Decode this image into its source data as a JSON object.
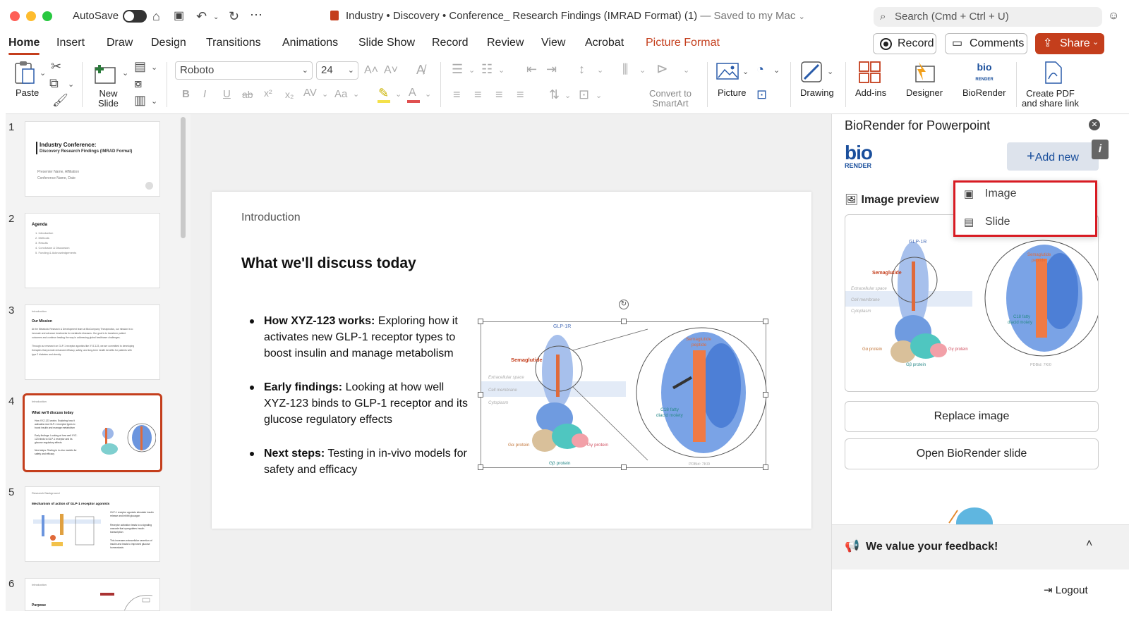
{
  "titlebar": {
    "autosave_label": "AutoSave",
    "document_title": "Industry • Discovery • Conference_ Research Findings (IMRAD Format) (1)",
    "save_status": "— Saved to my Mac",
    "search_placeholder": "Search (Cmd + Ctrl + U)"
  },
  "tabs": [
    "Home",
    "Insert",
    "Draw",
    "Design",
    "Transitions",
    "Animations",
    "Slide Show",
    "Record",
    "Review",
    "View",
    "Acrobat",
    "Picture Format"
  ],
  "active_tab": "Home",
  "actions": {
    "record": "Record",
    "comments": "Comments",
    "share": "Share"
  },
  "ribbon": {
    "paste": "Paste",
    "new_slide": [
      "New",
      "Slide"
    ],
    "font_name": "Roboto",
    "font_size": "24",
    "convert_smartart": [
      "Convert to",
      "SmartArt"
    ],
    "picture": "Picture",
    "drawing": "Drawing",
    "addins": "Add-ins",
    "designer": "Designer",
    "biorender": "BioRender",
    "create_pdf": [
      "Create PDF",
      "and share link"
    ]
  },
  "slides": [
    {
      "num": "1",
      "title": "Industry Conference:",
      "subtitle": "Discovery Research Findings (IMRAD Format)",
      "lines": [
        "Presenter Name, Affiliation",
        "Conference Name, Date"
      ]
    },
    {
      "num": "2",
      "title": "Agenda",
      "lines": [
        "1. Introduction",
        "2. Methods",
        "3. Results",
        "4. Conclusion & Discussion",
        "5. Funding & Acknowledgements"
      ]
    },
    {
      "num": "3",
      "eyebrow": "Introduction",
      "title": "Our Mission",
      "lines": [
        "At the Metabolic Research & Development team at BioCompany Therapeutics, our mission is to",
        "innovate and advance treatments for metabolic diseases. Our goal is to transform patient",
        "outcomes and continue leading the way in addressing global healthcare challenges.",
        "Through our research on GLP-1 receptor agonists like XYZ-123, we are committed to developing",
        "therapies that provide enhanced efficacy, safety, and long-term health benefits for patients with",
        "type 2 diabetes and obesity."
      ]
    },
    {
      "num": "4",
      "eyebrow": "Introduction",
      "title": "What we'll discuss today",
      "lines": [
        "How XYZ-123 works: Exploring how it",
        "activates new GLP-1 receptor types to",
        "boost insulin and manage metabolism",
        "Early findings: Looking at how well XYZ-",
        "123 binds to GLP-1 receptor and its",
        "glucose regulatory effects",
        "Next steps: Testing in in-vivo models for",
        "safety and efficacy"
      ]
    },
    {
      "num": "5",
      "eyebrow": "Research Background",
      "title": "Mechanism of action of GLP-1 receptor agonists",
      "lines": [
        "GLP-1 receptor agonists stimulate insulin",
        "release and inhibit glucagon",
        "Receptor activation leads to a signaling",
        "cascade that upregulates insulin",
        "transcription",
        "This increases extracellular secretion of",
        "insulin and leads to improved glucose",
        "homeostasis"
      ]
    },
    {
      "num": "6",
      "eyebrow": "Introduction",
      "title": "Purpose"
    }
  ],
  "selected_slide": 4,
  "slide": {
    "subtitle": "Introduction",
    "title": "What we'll discuss today",
    "bullets": [
      {
        "bold": "How XYZ-123 works:",
        "text": " Exploring how it activates new GLP-1 receptor types to boost insulin and manage metabolism"
      },
      {
        "bold": "Early findings:",
        "text": " Looking at how well XYZ-123 binds to GLP-1 receptor and its glucose regulatory effects"
      },
      {
        "bold": "Next steps:",
        "text": " Testing in in-vivo models for safety and efficacy"
      }
    ],
    "figure": {
      "labels": {
        "receptor": "GLP-1R",
        "ligand": "Semaglutide",
        "extracellular": "Extracellular space",
        "membrane": "Cell membrane",
        "cytoplasm": "Cytoplasm",
        "galpha": "Gα protein",
        "gbeta": "Gβ protein",
        "ggamma": "Gγ protein",
        "peptide": [
          "Semaglutide",
          "peptide"
        ],
        "moiety": [
          "C18 fatty",
          "diacid moiety"
        ],
        "pdb": "PDBid: 7KI0"
      }
    }
  },
  "panel": {
    "title": "BioRender for Powerpoint",
    "logo_top": "bio",
    "logo_bottom": "RENDER",
    "add_new": "Add new",
    "info": "i",
    "menu": [
      "Image",
      "Slide"
    ],
    "image_preview": "Image preview",
    "replace": "Replace image",
    "open_slide": "Open BioRender slide",
    "feedback": "We value your feedback!",
    "logout": "Logout"
  },
  "colors": {
    "accent": "#c43e1c",
    "highlight": "#d81b23",
    "biorender": "#1a4f9c"
  }
}
